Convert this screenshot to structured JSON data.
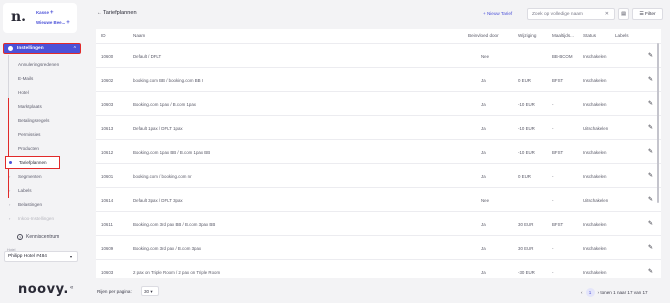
{
  "brand": {
    "line1": "Kasse",
    "line2": "Wieuwe Bee..."
  },
  "nav": {
    "parent_label": "Instellingen",
    "items": [
      "Annuleringsredenen",
      "E-Mails",
      "Hotel",
      "Marktplaats",
      "Betalingsregels",
      "Permissies",
      "Producten"
    ],
    "active_label": "Tariefplannen",
    "more_items": [
      "Segmenten",
      "Labels",
      "Belastingen",
      "Inkoo-Instellingen"
    ]
  },
  "help": {
    "label": "Kenniscentrum"
  },
  "hotel": {
    "label": "Hotel",
    "value": "Philipp Hotel #484"
  },
  "logo": "noovy.",
  "header": {
    "title": "Tariefplannen",
    "new_label": "+  Nieuw Tarief",
    "search_placeholder": "Zoek op volledige naam",
    "filter_label": "Filter"
  },
  "table": {
    "columns": [
      "ID",
      "Naam",
      "Beinvloed door",
      "Wijziging",
      "Maaltijds...",
      "Status",
      "Labels"
    ],
    "rows": [
      [
        "10600",
        "Default / DFLT",
        "Nee",
        "",
        "BB-BCOM",
        "Inschakelen",
        ""
      ],
      [
        "10602",
        "booking.com BB / booking.com BB I",
        "Ja",
        "0 EUR",
        "BFST",
        "Inschakelen",
        ""
      ],
      [
        "10603",
        "Booking.com 1pax / B.com 1pax",
        "Ja",
        "-10 EUR",
        "-",
        "Inschakelen",
        ""
      ],
      [
        "10613",
        "Default 1pax / DFLT 1pax",
        "Ja",
        "-10 EUR",
        "-",
        "Uitschakelen",
        ""
      ],
      [
        "10612",
        "Booking.com 1pax BB / B.com 1pax BB",
        "Ja",
        "-10 EUR",
        "BFST",
        "Inschakelen",
        ""
      ],
      [
        "10601",
        "booking.com / booking.com nr",
        "Ja",
        "0 EUR",
        "-",
        "Inschakelen",
        ""
      ],
      [
        "10614",
        "Default 3pax / DFLT 3pax",
        "Nee",
        "",
        "-",
        "Uitschakelen",
        ""
      ],
      [
        "10611",
        "Booking.com 3rd pax BB / B.com 3pax BB",
        "Ja",
        "30 EUR",
        "BFST",
        "Inschakelen",
        ""
      ],
      [
        "10609",
        "Booking.com 3rd pax / B.com 3pax",
        "Ja",
        "30 EUR",
        "-",
        "Inschakelen",
        ""
      ],
      [
        "10603",
        "2 pax on Triple Room / 2 pax on Triple Room",
        "Ja",
        "-30 EUR",
        "-",
        "Inschakelen",
        ""
      ]
    ]
  },
  "footer": {
    "rows_label": "Rijen per pagina:",
    "rows_value": "30",
    "page": "1",
    "range": "tonen 1 naar 17 van 17"
  }
}
